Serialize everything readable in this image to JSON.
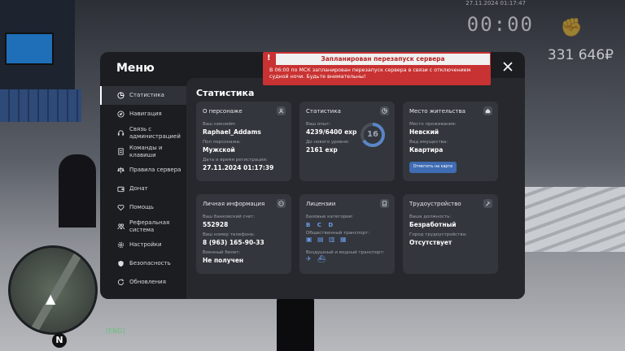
{
  "hud": {
    "datetime": "27.11.2024 01:17:47",
    "clock": "00:00",
    "money": "331 646₽",
    "bottom_text": "[ENG]",
    "compass": "N"
  },
  "menu": {
    "title": "Меню",
    "sidebar": [
      {
        "label": "Статистика",
        "icon": "stats-icon",
        "active": true
      },
      {
        "label": "Навигация",
        "icon": "compass-icon"
      },
      {
        "label": "Связь с администрацией",
        "icon": "headset-icon"
      },
      {
        "label": "Команды и клавиши",
        "icon": "document-icon"
      },
      {
        "label": "Правила сервера",
        "icon": "scales-icon"
      },
      {
        "label": "Донат",
        "icon": "wallet-icon"
      },
      {
        "label": "Помощь",
        "icon": "heart-icon"
      },
      {
        "label": "Реферальная система",
        "icon": "people-icon"
      },
      {
        "label": "Настройки",
        "icon": "gear-icon"
      },
      {
        "label": "Безопасность",
        "icon": "shield-icon"
      },
      {
        "label": "Обновления",
        "icon": "refresh-icon"
      }
    ]
  },
  "content": {
    "title": "Статистика",
    "about": {
      "heading": "О персонаже",
      "nick_label": "Ваш никнейм:",
      "nick": "Raphael_Addams",
      "gender_label": "Пол персонажа:",
      "gender": "Мужской",
      "reg_label": "Дата и время регистрации:",
      "reg": "27.11.2024 01:17:39"
    },
    "stats": {
      "heading": "Статистика",
      "exp_label": "Ваш опыт:",
      "exp": "4239/6400 exp",
      "next_label": "До нового уровня:",
      "next": "2161 exp",
      "level": "16",
      "progress": 0.66
    },
    "residence": {
      "heading": "Место жительства",
      "place_label": "Место проживания:",
      "place": "Невский",
      "prop_label": "Вид имущества:",
      "prop": "Квартира",
      "button": "Отметить на карте"
    },
    "personal": {
      "heading": "Личная информация",
      "bank_label": "Ваш банковский счет:",
      "bank": "552928",
      "phone_label": "Ваш номер телефона:",
      "phone": "8 (963) 165-90-33",
      "military_label": "Военный билет:",
      "military": "Не получен"
    },
    "licenses": {
      "heading": "Лицензии",
      "base_label": "Базовые категории:",
      "base": "B C D",
      "public_label": "Общественный транспорт:",
      "air_label": "Воздушный и водный транспорт:"
    },
    "job": {
      "heading": "Трудоустройство",
      "position_label": "Ваша должность:",
      "position": "Безработный",
      "city_label": "Город трудоустройства:",
      "city": "Отсутствует"
    }
  },
  "notification": {
    "title": "Запланирован перезапуск сервера",
    "text": "В 06:00 по МСК запланирован перезапуск сервера в связи с отключением судной ночи. Будьте внимательны!",
    "mark": "!"
  },
  "colors": {
    "accent": "#3f6cb3",
    "alert": "#c93232"
  }
}
